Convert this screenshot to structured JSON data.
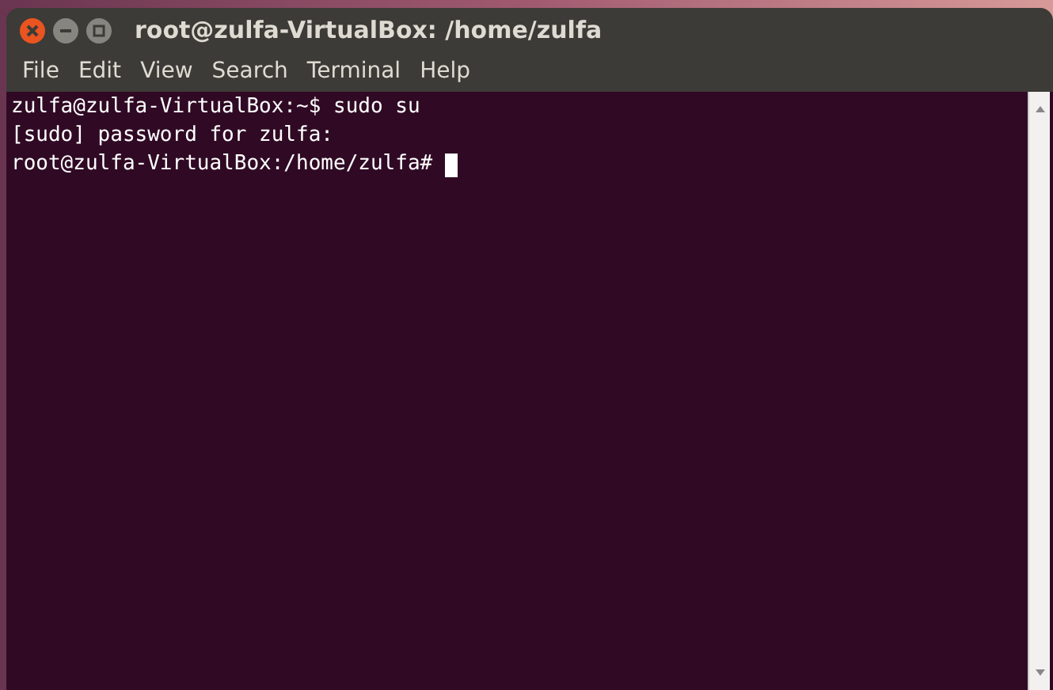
{
  "window": {
    "title": "root@zulfa-VirtualBox: /home/zulfa"
  },
  "menu": [
    "File",
    "Edit",
    "View",
    "Search",
    "Terminal",
    "Help"
  ],
  "terminal": {
    "lines": [
      "zulfa@zulfa-VirtualBox:~$ sudo su",
      "[sudo] password for zulfa:",
      "root@zulfa-VirtualBox:/home/zulfa#"
    ]
  }
}
